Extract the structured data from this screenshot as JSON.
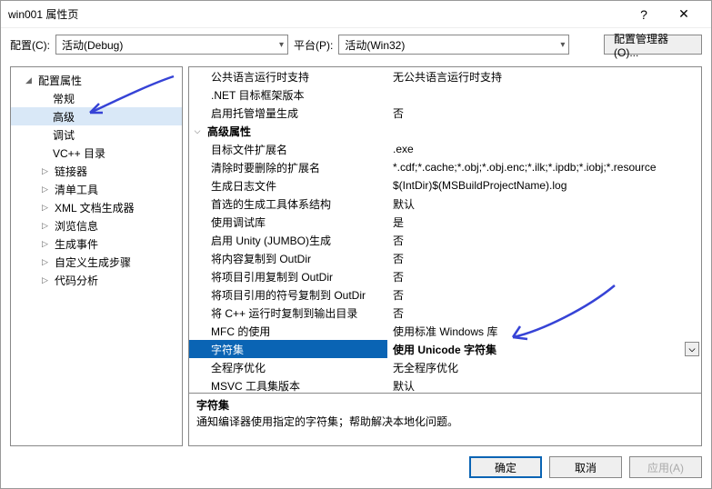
{
  "window": {
    "title": "win001 属性页"
  },
  "titlebar_buttons": {
    "help": "?",
    "close": "✕"
  },
  "toolbar": {
    "config_label": "配置(C):",
    "config_value": "活动(Debug)",
    "platform_label": "平台(P):",
    "platform_value": "活动(Win32)",
    "config_manager": "配置管理器(O)..."
  },
  "tree": {
    "root": "配置属性",
    "items": [
      {
        "label": "常规",
        "collapsible": false
      },
      {
        "label": "高级",
        "collapsible": false,
        "selected": true
      },
      {
        "label": "调试",
        "collapsible": false
      },
      {
        "label": "VC++ 目录",
        "collapsible": false
      },
      {
        "label": "链接器",
        "collapsible": true
      },
      {
        "label": "清单工具",
        "collapsible": true
      },
      {
        "label": "XML 文档生成器",
        "collapsible": true
      },
      {
        "label": "浏览信息",
        "collapsible": true
      },
      {
        "label": "生成事件",
        "collapsible": true
      },
      {
        "label": "自定义生成步骤",
        "collapsible": true
      },
      {
        "label": "代码分析",
        "collapsible": true
      }
    ]
  },
  "grid": {
    "group1_rows": [
      {
        "label": "公共语言运行时支持",
        "value": "无公共语言运行时支持"
      },
      {
        "label": ".NET 目标框架版本",
        "value": ""
      },
      {
        "label": "启用托管增量生成",
        "value": "否"
      }
    ],
    "group2_label": "高级属性",
    "group2_rows": [
      {
        "label": "目标文件扩展名",
        "value": ".exe"
      },
      {
        "label": "清除时要删除的扩展名",
        "value": "*.cdf;*.cache;*.obj;*.obj.enc;*.ilk;*.ipdb;*.iobj;*.resource"
      },
      {
        "label": "生成日志文件",
        "value": "$(IntDir)$(MSBuildProjectName).log"
      },
      {
        "label": "首选的生成工具体系结构",
        "value": "默认"
      },
      {
        "label": "使用调试库",
        "value": "是"
      },
      {
        "label": "启用 Unity (JUMBO)生成",
        "value": "否"
      },
      {
        "label": "将内容复制到 OutDir",
        "value": "否"
      },
      {
        "label": "将项目引用复制到 OutDir",
        "value": "否"
      },
      {
        "label": "将项目引用的符号复制到 OutDir",
        "value": "否"
      },
      {
        "label": "将 C++ 运行时复制到输出目录",
        "value": "否"
      },
      {
        "label": "MFC 的使用",
        "value": "使用标准 Windows 库"
      },
      {
        "label": "字符集",
        "value": "使用 Unicode 字符集",
        "selected": true
      },
      {
        "label": "全程序优化",
        "value": "无全程序优化"
      },
      {
        "label": "MSVC 工具集版本",
        "value": "默认"
      }
    ]
  },
  "description": {
    "title": "字符集",
    "text": "通知编译器使用指定的字符集；帮助解决本地化问题。"
  },
  "buttons": {
    "ok": "确定",
    "cancel": "取消",
    "apply": "应用(A)"
  },
  "annotation_color": "#3643d6"
}
